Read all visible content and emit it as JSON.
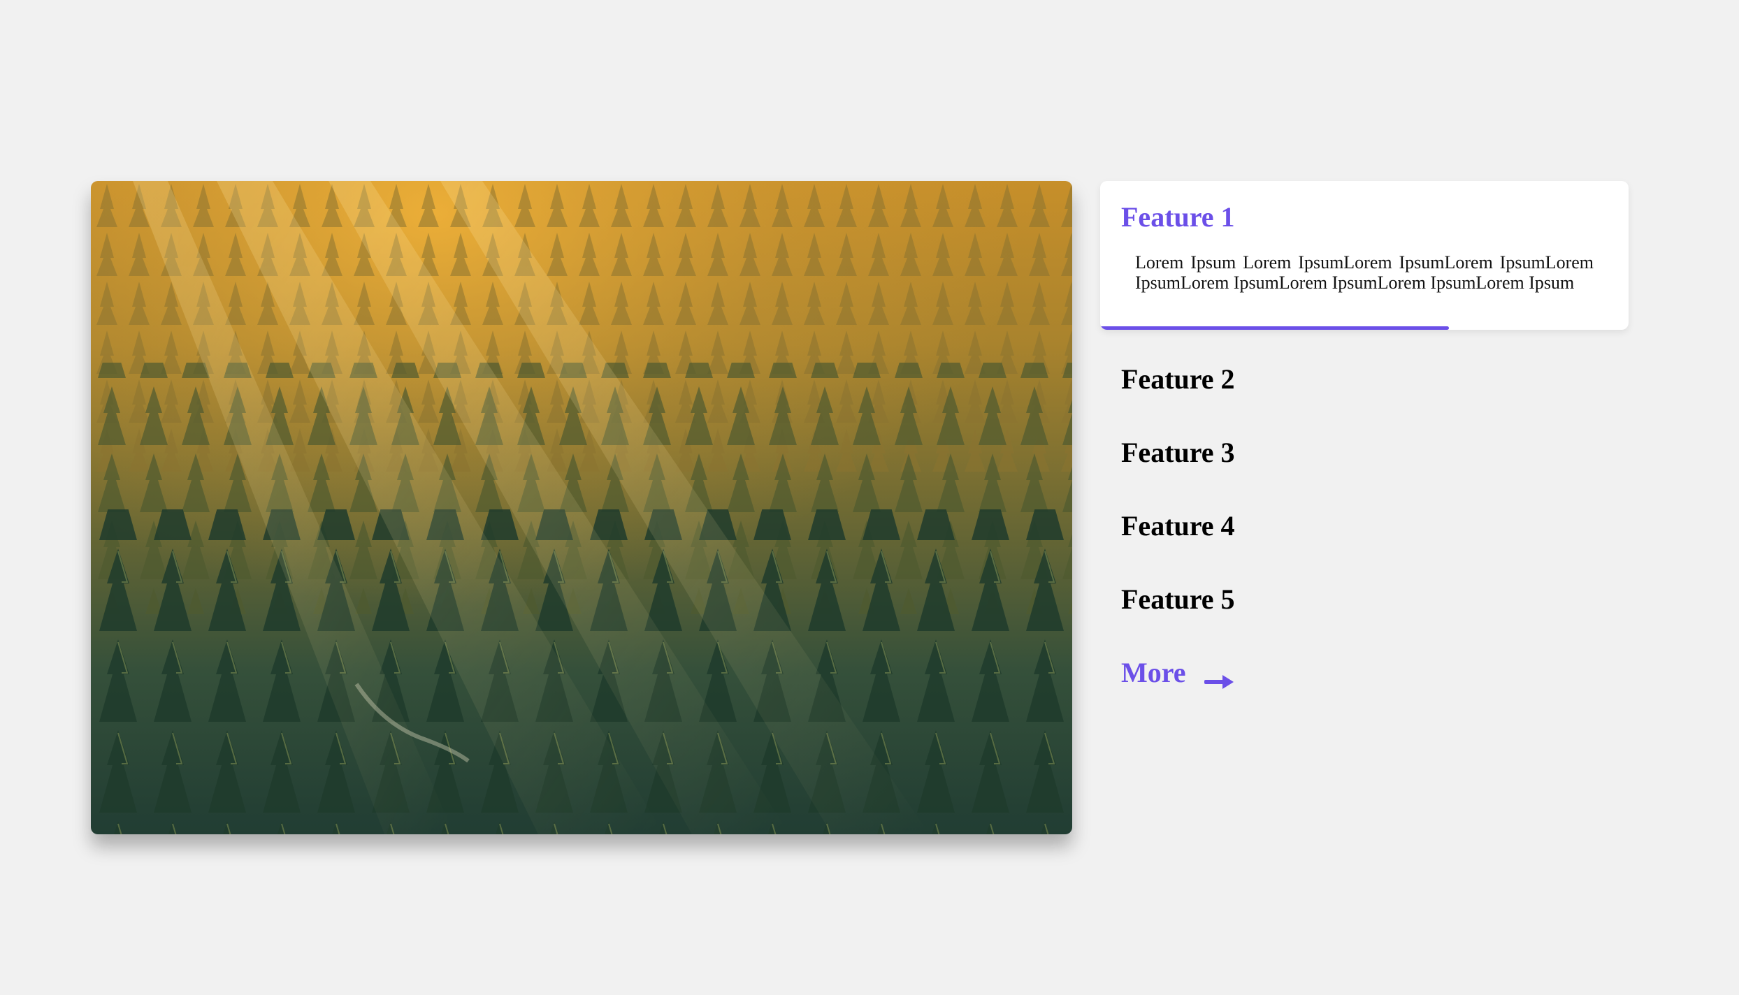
{
  "hero": {
    "image_subject": "sunlit pine forest with light rays"
  },
  "features": {
    "active": {
      "title": "Feature 1",
      "description": "Lorem Ipsum Lorem IpsumLorem IpsumLorem IpsumLorem IpsumLorem IpsumLorem IpsumLorem IpsumLorem Ipsum",
      "progress": 0.66
    },
    "items": [
      {
        "label": "Feature 2"
      },
      {
        "label": "Feature 3"
      },
      {
        "label": "Feature 4"
      },
      {
        "label": "Feature 5"
      }
    ],
    "more_label": "More"
  },
  "colors": {
    "accent": "#6b4fe8",
    "background": "#f1f1f1",
    "card": "#ffffff"
  },
  "icons": {
    "more_arrow": "arrow-right-icon"
  }
}
